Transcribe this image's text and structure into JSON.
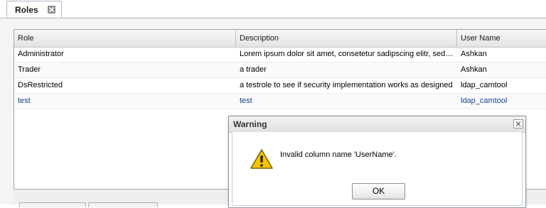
{
  "tab": {
    "label": "Roles"
  },
  "grid": {
    "columns": [
      "Role",
      "Description",
      "User Name"
    ],
    "rows": [
      {
        "role": "Administrator",
        "description": "Lorem ipsum dolor sit amet, consetetur sadipscing elitr, sed diam nonumy eirmod tempor",
        "user": "Ashkan"
      },
      {
        "role": "Trader",
        "description": "a trader",
        "user": "Ashkan"
      },
      {
        "role": "DsRestricted",
        "description": "a testrole to see if security implementation works as designed",
        "user": "ldap_camtool"
      },
      {
        "role": "test",
        "description": "test",
        "user": "ldap_camtool"
      }
    ]
  },
  "dialog": {
    "title": "Warning",
    "message": "Invalid column name 'UserName'.",
    "ok_label": "OK"
  },
  "colors": {
    "link": "#15428b",
    "warning": "#f5c400"
  }
}
